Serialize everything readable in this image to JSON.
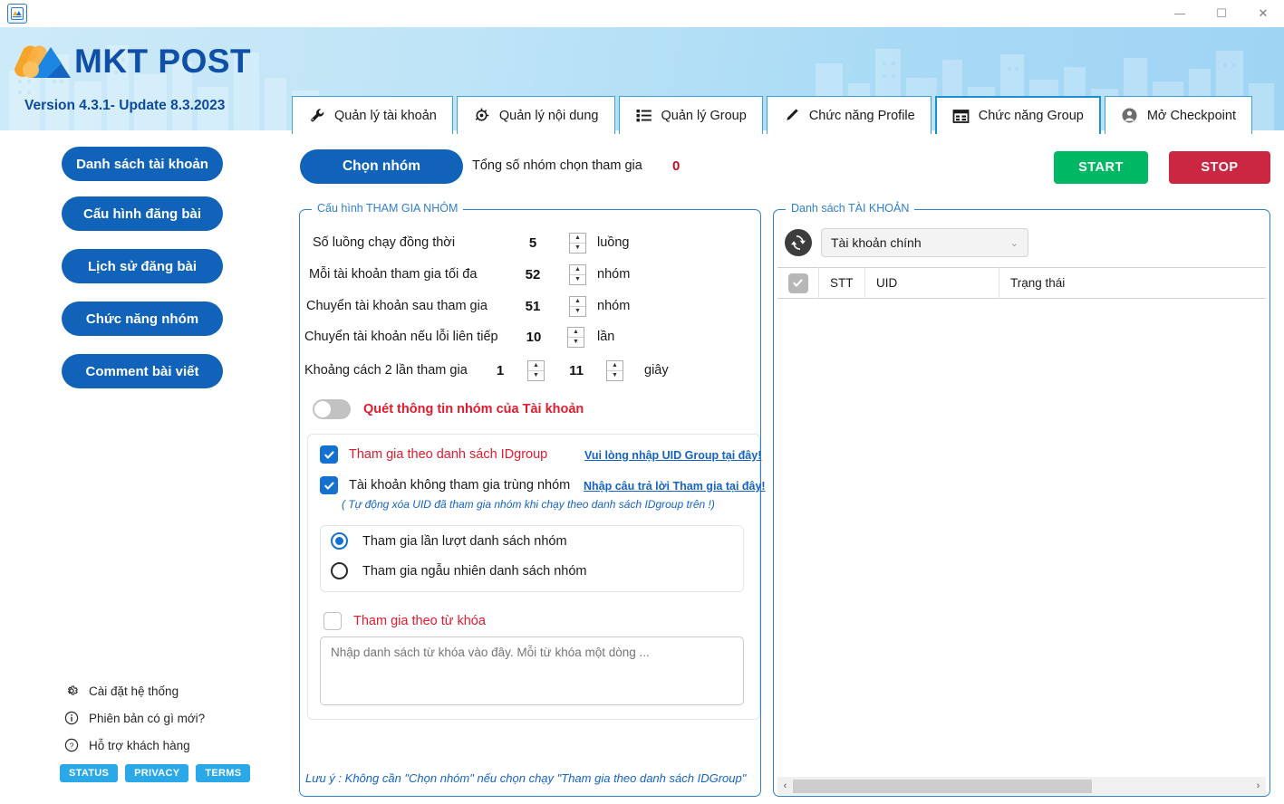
{
  "window": {
    "app_icon": "app-icon",
    "minimize": "—",
    "maximize": "☐",
    "close": "✕"
  },
  "header": {
    "brand": "MKT POST",
    "version": "Version 4.3.1- Update 8.3.2023"
  },
  "tabs": [
    {
      "label": "Quản lý tài khoản",
      "icon": "wrench-icon",
      "active": false
    },
    {
      "label": "Quản lý nội dung",
      "icon": "refresh-content-icon",
      "active": false
    },
    {
      "label": "Quản lý Group",
      "icon": "list-icon",
      "active": false
    },
    {
      "label": "Chức năng Profile",
      "icon": "pencil-icon",
      "active": false
    },
    {
      "label": "Chức năng Group",
      "icon": "window-grid-icon",
      "active": true
    },
    {
      "label": "Mở Checkpoint",
      "icon": "user-circle-icon",
      "active": false
    }
  ],
  "sidebar": {
    "buttons": [
      {
        "label": "Danh sách tài khoản"
      },
      {
        "label": "Cấu hình đăng bài"
      },
      {
        "label": "Lịch sử đăng bài"
      },
      {
        "label": "Chức năng nhóm"
      },
      {
        "label": "Comment bài viết"
      }
    ],
    "links": [
      {
        "label": "Cài đặt hệ thống",
        "icon": "gear-icon"
      },
      {
        "label": "Phiên bản có gì mới?",
        "icon": "info-icon"
      },
      {
        "label": "Hỗ trợ khách hàng",
        "icon": "question-icon"
      }
    ],
    "badges": [
      {
        "label": "STATUS"
      },
      {
        "label": "PRIVACY"
      },
      {
        "label": "TERMS"
      }
    ]
  },
  "toolbar": {
    "chon_nhom": "Chọn nhóm",
    "total_label": "Tổng số nhóm chọn tham gia",
    "total_value": "0",
    "start": "START",
    "stop": "STOP"
  },
  "left_panel": {
    "title": "Cấu hình THAM GIA NHÓM",
    "rows": [
      {
        "label": "Số luồng chạy đồng thời",
        "value": "5",
        "unit": "luồng"
      },
      {
        "label": "Mỗi tài khoản tham gia tối đa",
        "value": "52",
        "unit": "nhóm"
      },
      {
        "label": "Chuyển tài khoản sau tham gia",
        "value": "51",
        "unit": "nhóm"
      },
      {
        "label": "Chuyển tài khoản nếu lỗi liên tiếp",
        "value": "10",
        "unit": "lần"
      }
    ],
    "interval": {
      "label": "Khoảng cách 2 lần tham gia",
      "value_min": "1",
      "value_max": "11",
      "unit": "giây"
    },
    "scan_toggle": {
      "label": "Quét thông tin nhóm của Tài khoản",
      "state": "off"
    },
    "checkbox_idgroup": {
      "label": "Tham gia theo danh sách IDgroup",
      "checked": true,
      "link": "Vui lòng nhập UID Group tại đây!"
    },
    "checkbox_notrung": {
      "label": "Tài khoản không tham gia trùng nhóm",
      "checked": true,
      "link": "Nhập câu trả lời Tham gia tại đây!"
    },
    "note": "( Tự động xóa UID đã tham gia nhóm khi chạy theo danh sách IDgroup trên !)",
    "radios": [
      {
        "label": "Tham gia lần lượt danh sách nhóm",
        "selected": true
      },
      {
        "label": "Tham gia ngẫu nhiên danh sách nhóm",
        "selected": false
      }
    ],
    "keyword_checkbox": {
      "label": "Tham gia theo từ khóa",
      "checked": false
    },
    "keyword_placeholder": "Nhập danh sách từ khóa vào đây. Mỗi từ khóa một dòng ...",
    "keyword_value": "",
    "footer_note": "Lưu ý : Không cần \"Chọn nhóm\" nếu chọn chạy \"Tham gia theo danh sách IDGroup\""
  },
  "right_panel": {
    "title": "Danh sách TÀI KHOẢN",
    "refresh_icon": "refresh-icon",
    "account_select": {
      "value": "Tài khoản chính",
      "chevron": "⌄"
    },
    "columns": [
      "STT",
      "UID",
      "Trạng thái"
    ],
    "rows": [],
    "scroll_left": "‹",
    "scroll_right": "›"
  },
  "colors": {
    "primary_blue": "#1063b8",
    "accent_blue": "#2f7fd0",
    "red": "#e01b2e",
    "green": "#00b863",
    "stop_red": "#cc2742",
    "header_blue": "#bfe4f7",
    "badge_blue": "#2aa8e8"
  }
}
